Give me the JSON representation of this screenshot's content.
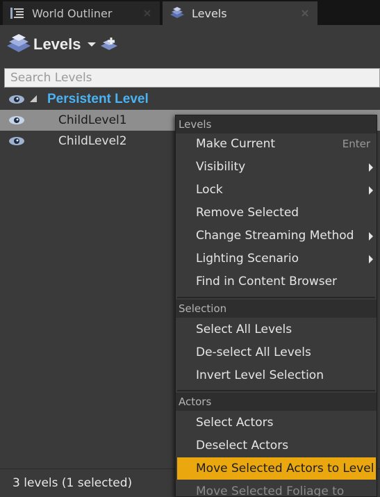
{
  "tabs": [
    {
      "label": "World Outliner",
      "icon": "list-icon",
      "active": false
    },
    {
      "label": "Levels",
      "icon": "levels-icon",
      "active": true
    }
  ],
  "toolbar": {
    "levels_label": "Levels",
    "dropdown_icon": "chevron-down-icon",
    "add_level_icon": "add-level-icon"
  },
  "search": {
    "placeholder": "Search Levels",
    "value": ""
  },
  "levels": [
    {
      "name": "Persistent Level",
      "visible": true,
      "expanded": true,
      "selected": false
    },
    {
      "name": "ChildLevel1",
      "visible": true,
      "selected": true
    },
    {
      "name": "ChildLevel2",
      "visible": true,
      "selected": false
    }
  ],
  "status": {
    "text": "3 levels (1 selected)"
  },
  "context_menu": {
    "sections": [
      {
        "header": "Levels",
        "items": [
          {
            "label": "Make Current",
            "shortcut": "Enter"
          },
          {
            "label": "Visibility",
            "submenu": true
          },
          {
            "label": "Lock",
            "submenu": true
          },
          {
            "label": "Remove Selected"
          },
          {
            "label": "Change Streaming Method",
            "submenu": true
          },
          {
            "label": "Lighting Scenario",
            "submenu": true
          },
          {
            "label": "Find in Content Browser"
          }
        ]
      },
      {
        "header": "Selection",
        "items": [
          {
            "label": "Select All Levels"
          },
          {
            "label": "De-select All Levels"
          },
          {
            "label": "Invert Level Selection"
          }
        ]
      },
      {
        "header": "Actors",
        "items": [
          {
            "label": "Select Actors"
          },
          {
            "label": "Deselect Actors"
          },
          {
            "label": "Move Selected Actors to Level",
            "highlighted": true
          },
          {
            "label": "Move Selected Foliage to Level",
            "disabled": true
          }
        ]
      }
    ]
  },
  "colors": {
    "persistent_level_text": "#4ab3f4",
    "highlight": "#eaa80e",
    "selected_row": "#8e8e8e",
    "panel_bg": "#3a3a3a"
  }
}
